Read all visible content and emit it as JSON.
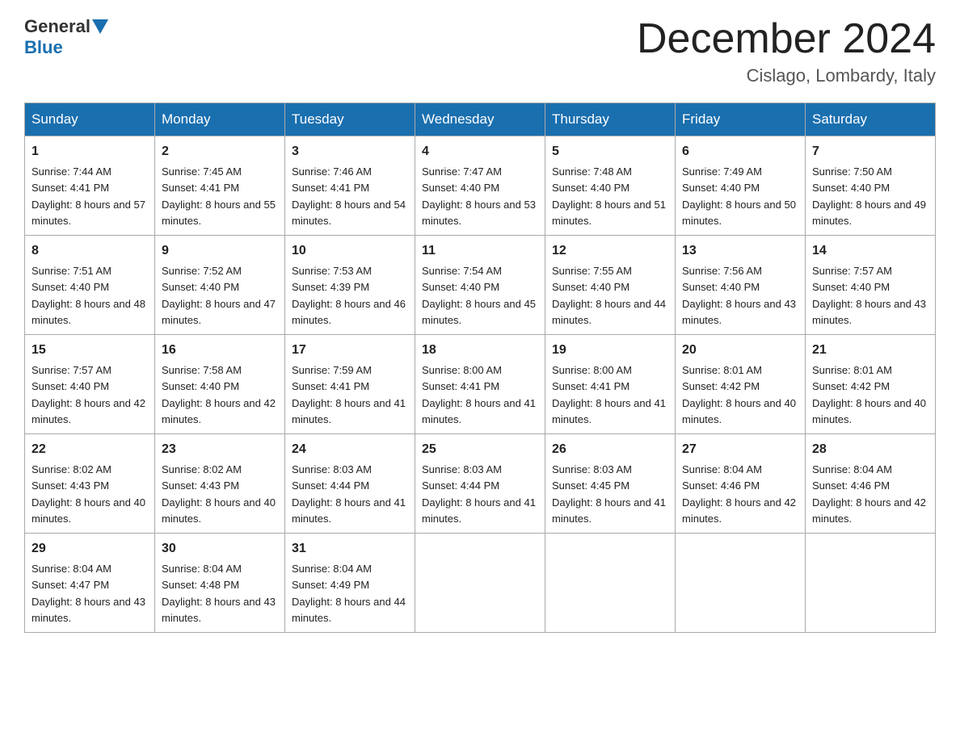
{
  "logo": {
    "general": "General",
    "blue": "Blue"
  },
  "title": "December 2024",
  "location": "Cislago, Lombardy, Italy",
  "days_of_week": [
    "Sunday",
    "Monday",
    "Tuesday",
    "Wednesday",
    "Thursday",
    "Friday",
    "Saturday"
  ],
  "weeks": [
    [
      {
        "num": "1",
        "sunrise": "7:44 AM",
        "sunset": "4:41 PM",
        "daylight": "8 hours and 57 minutes."
      },
      {
        "num": "2",
        "sunrise": "7:45 AM",
        "sunset": "4:41 PM",
        "daylight": "8 hours and 55 minutes."
      },
      {
        "num": "3",
        "sunrise": "7:46 AM",
        "sunset": "4:41 PM",
        "daylight": "8 hours and 54 minutes."
      },
      {
        "num": "4",
        "sunrise": "7:47 AM",
        "sunset": "4:40 PM",
        "daylight": "8 hours and 53 minutes."
      },
      {
        "num": "5",
        "sunrise": "7:48 AM",
        "sunset": "4:40 PM",
        "daylight": "8 hours and 51 minutes."
      },
      {
        "num": "6",
        "sunrise": "7:49 AM",
        "sunset": "4:40 PM",
        "daylight": "8 hours and 50 minutes."
      },
      {
        "num": "7",
        "sunrise": "7:50 AM",
        "sunset": "4:40 PM",
        "daylight": "8 hours and 49 minutes."
      }
    ],
    [
      {
        "num": "8",
        "sunrise": "7:51 AM",
        "sunset": "4:40 PM",
        "daylight": "8 hours and 48 minutes."
      },
      {
        "num": "9",
        "sunrise": "7:52 AM",
        "sunset": "4:40 PM",
        "daylight": "8 hours and 47 minutes."
      },
      {
        "num": "10",
        "sunrise": "7:53 AM",
        "sunset": "4:39 PM",
        "daylight": "8 hours and 46 minutes."
      },
      {
        "num": "11",
        "sunrise": "7:54 AM",
        "sunset": "4:40 PM",
        "daylight": "8 hours and 45 minutes."
      },
      {
        "num": "12",
        "sunrise": "7:55 AM",
        "sunset": "4:40 PM",
        "daylight": "8 hours and 44 minutes."
      },
      {
        "num": "13",
        "sunrise": "7:56 AM",
        "sunset": "4:40 PM",
        "daylight": "8 hours and 43 minutes."
      },
      {
        "num": "14",
        "sunrise": "7:57 AM",
        "sunset": "4:40 PM",
        "daylight": "8 hours and 43 minutes."
      }
    ],
    [
      {
        "num": "15",
        "sunrise": "7:57 AM",
        "sunset": "4:40 PM",
        "daylight": "8 hours and 42 minutes."
      },
      {
        "num": "16",
        "sunrise": "7:58 AM",
        "sunset": "4:40 PM",
        "daylight": "8 hours and 42 minutes."
      },
      {
        "num": "17",
        "sunrise": "7:59 AM",
        "sunset": "4:41 PM",
        "daylight": "8 hours and 41 minutes."
      },
      {
        "num": "18",
        "sunrise": "8:00 AM",
        "sunset": "4:41 PM",
        "daylight": "8 hours and 41 minutes."
      },
      {
        "num": "19",
        "sunrise": "8:00 AM",
        "sunset": "4:41 PM",
        "daylight": "8 hours and 41 minutes."
      },
      {
        "num": "20",
        "sunrise": "8:01 AM",
        "sunset": "4:42 PM",
        "daylight": "8 hours and 40 minutes."
      },
      {
        "num": "21",
        "sunrise": "8:01 AM",
        "sunset": "4:42 PM",
        "daylight": "8 hours and 40 minutes."
      }
    ],
    [
      {
        "num": "22",
        "sunrise": "8:02 AM",
        "sunset": "4:43 PM",
        "daylight": "8 hours and 40 minutes."
      },
      {
        "num": "23",
        "sunrise": "8:02 AM",
        "sunset": "4:43 PM",
        "daylight": "8 hours and 40 minutes."
      },
      {
        "num": "24",
        "sunrise": "8:03 AM",
        "sunset": "4:44 PM",
        "daylight": "8 hours and 41 minutes."
      },
      {
        "num": "25",
        "sunrise": "8:03 AM",
        "sunset": "4:44 PM",
        "daylight": "8 hours and 41 minutes."
      },
      {
        "num": "26",
        "sunrise": "8:03 AM",
        "sunset": "4:45 PM",
        "daylight": "8 hours and 41 minutes."
      },
      {
        "num": "27",
        "sunrise": "8:04 AM",
        "sunset": "4:46 PM",
        "daylight": "8 hours and 42 minutes."
      },
      {
        "num": "28",
        "sunrise": "8:04 AM",
        "sunset": "4:46 PM",
        "daylight": "8 hours and 42 minutes."
      }
    ],
    [
      {
        "num": "29",
        "sunrise": "8:04 AM",
        "sunset": "4:47 PM",
        "daylight": "8 hours and 43 minutes."
      },
      {
        "num": "30",
        "sunrise": "8:04 AM",
        "sunset": "4:48 PM",
        "daylight": "8 hours and 43 minutes."
      },
      {
        "num": "31",
        "sunrise": "8:04 AM",
        "sunset": "4:49 PM",
        "daylight": "8 hours and 44 minutes."
      },
      null,
      null,
      null,
      null
    ]
  ]
}
